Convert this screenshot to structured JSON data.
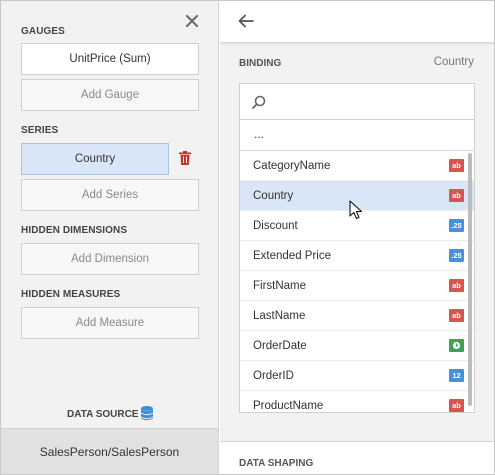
{
  "left": {
    "sections": {
      "gauges": {
        "title": "GAUGES",
        "item": "UnitPrice (Sum)",
        "add": "Add Gauge"
      },
      "series": {
        "title": "SERIES",
        "item": "Country",
        "add": "Add Series"
      },
      "hidden_dimensions": {
        "title": "HIDDEN DIMENSIONS",
        "add": "Add Dimension"
      },
      "hidden_measures": {
        "title": "HIDDEN MEASURES",
        "add": "Add Measure"
      }
    },
    "data_source": {
      "label": "DATA SOURCE",
      "value": "SalesPerson/SalesPerson"
    }
  },
  "right": {
    "binding": {
      "title": "BINDING",
      "value": "Country"
    },
    "search": {
      "placeholder": ""
    },
    "list": {
      "ellipsis": "...",
      "fields": [
        {
          "name": "CategoryName",
          "badge": "ab",
          "type": "text"
        },
        {
          "name": "Country",
          "badge": "ab",
          "type": "text",
          "selected": true
        },
        {
          "name": "Discount",
          "badge": ".25",
          "type": "num"
        },
        {
          "name": "Extended Price",
          "badge": ".25",
          "type": "num"
        },
        {
          "name": "FirstName",
          "badge": "ab",
          "type": "text"
        },
        {
          "name": "LastName",
          "badge": "ab",
          "type": "text"
        },
        {
          "name": "OrderDate",
          "badge": "",
          "type": "date"
        },
        {
          "name": "OrderID",
          "badge": "12",
          "type": "num"
        },
        {
          "name": "ProductName",
          "badge": "ab",
          "type": "text"
        }
      ]
    },
    "data_shaping": {
      "title": "DATA SHAPING"
    }
  },
  "colors": {
    "selection": "#d9e6f8",
    "text_badge": "#d9534f",
    "number_badge": "#4a90d9",
    "date_badge": "#3aa357",
    "trash": "#c9302c"
  },
  "icons": [
    "close-icon",
    "trash-icon",
    "database-icon",
    "back-arrow-icon",
    "search-icon",
    "clock-icon",
    "mouse-cursor-icon"
  ]
}
